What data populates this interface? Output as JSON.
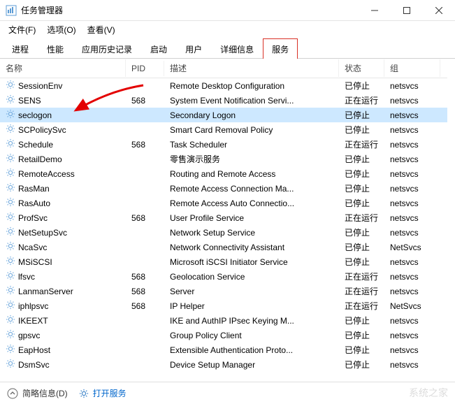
{
  "title": "任务管理器",
  "menus": [
    "文件(F)",
    "选项(O)",
    "查看(V)"
  ],
  "tabs": [
    "进程",
    "性能",
    "应用历史记录",
    "启动",
    "用户",
    "详细信息",
    "服务"
  ],
  "active_tab_index": 6,
  "columns": {
    "name": "名称",
    "pid": "PID",
    "desc": "描述",
    "status": "状态",
    "group": "组"
  },
  "rows": [
    {
      "name": "SessionEnv",
      "pid": "",
      "desc": "Remote Desktop Configuration",
      "status": "已停止",
      "group": "netsvcs",
      "selected": false
    },
    {
      "name": "SENS",
      "pid": "568",
      "desc": "System Event Notification Servi...",
      "status": "正在运行",
      "group": "netsvcs",
      "selected": false
    },
    {
      "name": "seclogon",
      "pid": "",
      "desc": "Secondary Logon",
      "status": "已停止",
      "group": "netsvcs",
      "selected": true
    },
    {
      "name": "SCPolicySvc",
      "pid": "",
      "desc": "Smart Card Removal Policy",
      "status": "已停止",
      "group": "netsvcs",
      "selected": false
    },
    {
      "name": "Schedule",
      "pid": "568",
      "desc": "Task Scheduler",
      "status": "正在运行",
      "group": "netsvcs",
      "selected": false
    },
    {
      "name": "RetailDemo",
      "pid": "",
      "desc": "零售演示服务",
      "status": "已停止",
      "group": "netsvcs",
      "selected": false
    },
    {
      "name": "RemoteAccess",
      "pid": "",
      "desc": "Routing and Remote Access",
      "status": "已停止",
      "group": "netsvcs",
      "selected": false
    },
    {
      "name": "RasMan",
      "pid": "",
      "desc": "Remote Access Connection Ma...",
      "status": "已停止",
      "group": "netsvcs",
      "selected": false
    },
    {
      "name": "RasAuto",
      "pid": "",
      "desc": "Remote Access Auto Connectio...",
      "status": "已停止",
      "group": "netsvcs",
      "selected": false
    },
    {
      "name": "ProfSvc",
      "pid": "568",
      "desc": "User Profile Service",
      "status": "正在运行",
      "group": "netsvcs",
      "selected": false
    },
    {
      "name": "NetSetupSvc",
      "pid": "",
      "desc": "Network Setup Service",
      "status": "已停止",
      "group": "netsvcs",
      "selected": false
    },
    {
      "name": "NcaSvc",
      "pid": "",
      "desc": "Network Connectivity Assistant",
      "status": "已停止",
      "group": "NetSvcs",
      "selected": false
    },
    {
      "name": "MSiSCSI",
      "pid": "",
      "desc": "Microsoft iSCSI Initiator Service",
      "status": "已停止",
      "group": "netsvcs",
      "selected": false
    },
    {
      "name": "lfsvc",
      "pid": "568",
      "desc": "Geolocation Service",
      "status": "正在运行",
      "group": "netsvcs",
      "selected": false
    },
    {
      "name": "LanmanServer",
      "pid": "568",
      "desc": "Server",
      "status": "正在运行",
      "group": "netsvcs",
      "selected": false
    },
    {
      "name": "iphlpsvc",
      "pid": "568",
      "desc": "IP Helper",
      "status": "正在运行",
      "group": "NetSvcs",
      "selected": false
    },
    {
      "name": "IKEEXT",
      "pid": "",
      "desc": "IKE and AuthIP IPsec Keying M...",
      "status": "已停止",
      "group": "netsvcs",
      "selected": false
    },
    {
      "name": "gpsvc",
      "pid": "",
      "desc": "Group Policy Client",
      "status": "已停止",
      "group": "netsvcs",
      "selected": false
    },
    {
      "name": "EapHost",
      "pid": "",
      "desc": "Extensible Authentication Proto...",
      "status": "已停止",
      "group": "netsvcs",
      "selected": false
    },
    {
      "name": "DsmSvc",
      "pid": "",
      "desc": "Device Setup Manager",
      "status": "已停止",
      "group": "netsvcs",
      "selected": false
    }
  ],
  "bottom": {
    "brief": "简略信息(D)",
    "open": "打开服务"
  },
  "watermark": "系统之家"
}
